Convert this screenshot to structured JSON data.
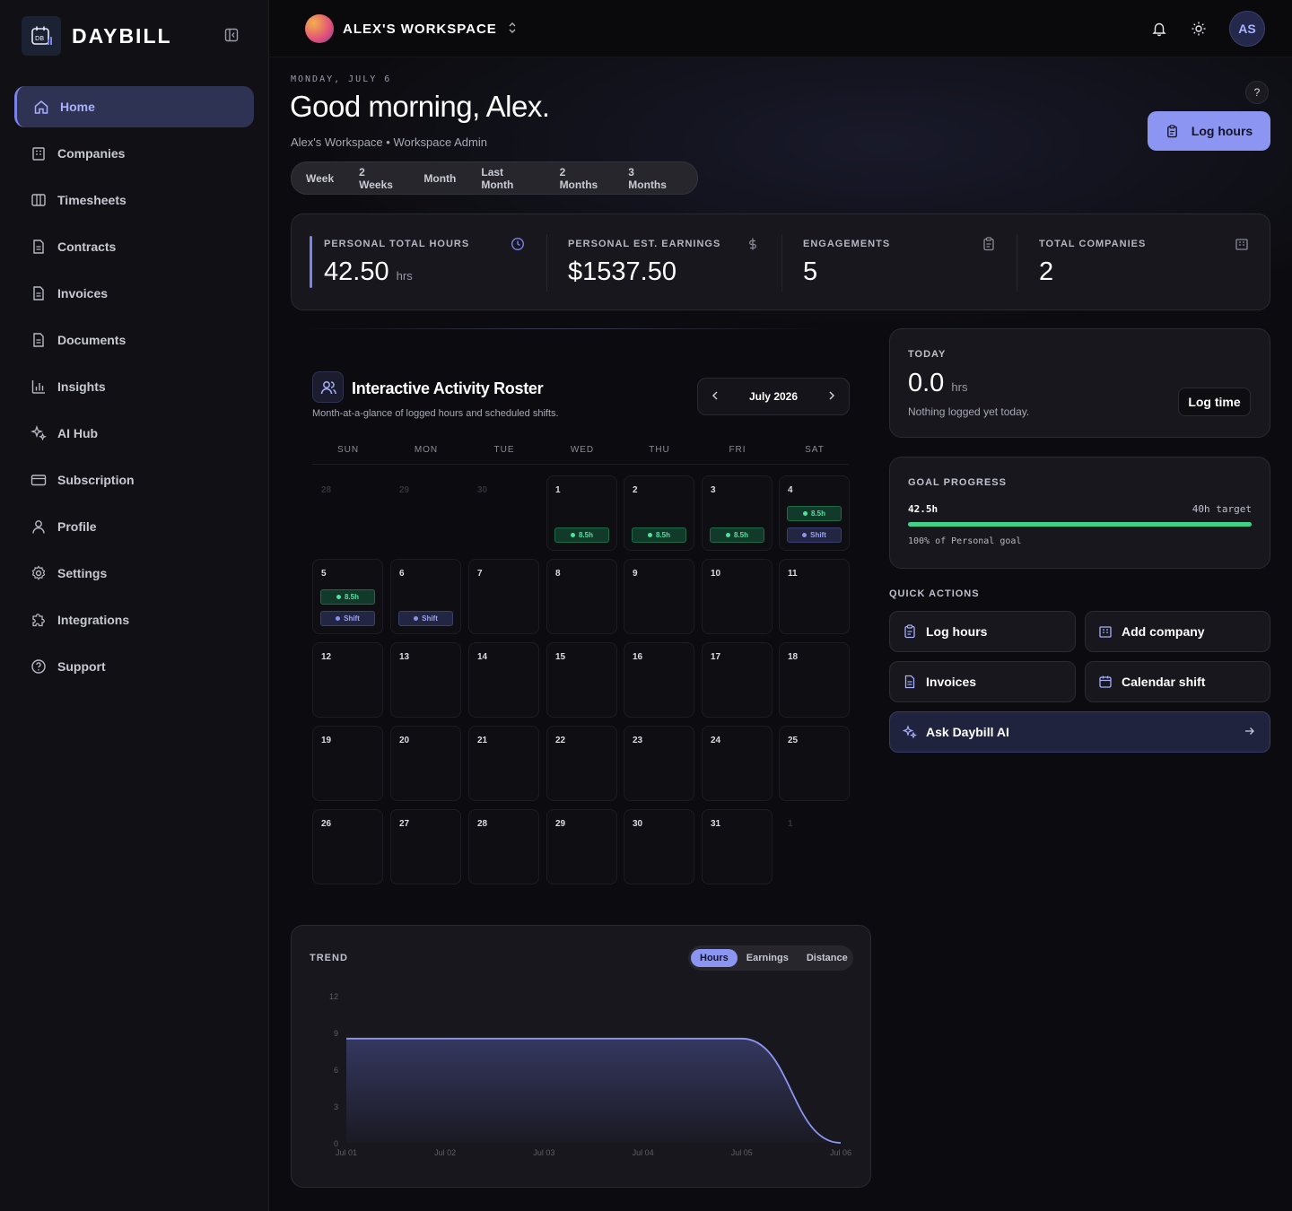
{
  "brand": {
    "name": "DAYBILL",
    "logo_text": "DB"
  },
  "sidebar": {
    "items": [
      {
        "label": "Home",
        "icon": "home-icon",
        "active": true
      },
      {
        "label": "Companies",
        "icon": "building-icon"
      },
      {
        "label": "Timesheets",
        "icon": "columns-icon"
      },
      {
        "label": "Contracts",
        "icon": "document-icon"
      },
      {
        "label": "Invoices",
        "icon": "document-icon"
      },
      {
        "label": "Documents",
        "icon": "document-icon"
      },
      {
        "label": "Insights",
        "icon": "bar-chart-icon"
      },
      {
        "label": "AI Hub",
        "icon": "sparkles-icon"
      },
      {
        "label": "Subscription",
        "icon": "card-icon"
      },
      {
        "label": "Profile",
        "icon": "user-icon"
      },
      {
        "label": "Settings",
        "icon": "gear-icon"
      },
      {
        "label": "Integrations",
        "icon": "puzzle-icon"
      },
      {
        "label": "Support",
        "icon": "help-circle-icon"
      }
    ]
  },
  "topbar": {
    "workspace": "ALEX'S WORKSPACE",
    "avatar_initials": "AS"
  },
  "header": {
    "date": "MONDAY, JULY 6",
    "greeting": "Good morning, Alex.",
    "subtitle": "Alex's Workspace • Workspace Admin",
    "help": "?",
    "log_hours_label": "Log hours",
    "ranges": [
      "Week",
      "2 Weeks",
      "Month",
      "Last Month",
      "2 Months",
      "3 Months"
    ]
  },
  "stats": [
    {
      "label": "PERSONAL TOTAL HOURS",
      "value": "42.50",
      "unit": "hrs",
      "icon": "clock-icon"
    },
    {
      "label": "PERSONAL EST. EARNINGS",
      "value": "$1537.50",
      "unit": "",
      "icon": "dollar-icon"
    },
    {
      "label": "ENGAGEMENTS",
      "value": "5",
      "unit": "",
      "icon": "clipboard-icon"
    },
    {
      "label": "TOTAL COMPANIES",
      "value": "2",
      "unit": "",
      "icon": "building-icon"
    }
  ],
  "calendar": {
    "title": "Interactive Activity Roster",
    "subtitle": "Month-at-a-glance of logged hours and scheduled shifts.",
    "month": "July 2026",
    "weekdays": [
      "SUN",
      "MON",
      "TUE",
      "WED",
      "THU",
      "FRI",
      "SAT"
    ],
    "weeks": [
      [
        {
          "d": "28",
          "out": true
        },
        {
          "d": "29",
          "out": true
        },
        {
          "d": "30",
          "out": true
        },
        {
          "d": "1",
          "hours": "8.5h"
        },
        {
          "d": "2",
          "hours": "8.5h"
        },
        {
          "d": "3",
          "hours": "8.5h"
        },
        {
          "d": "4",
          "hours": "8.5h",
          "shift": "Shift"
        }
      ],
      [
        {
          "d": "5",
          "hours": "8.5h",
          "shift": "Shift"
        },
        {
          "d": "6",
          "shift": "Shift"
        },
        {
          "d": "7"
        },
        {
          "d": "8"
        },
        {
          "d": "9"
        },
        {
          "d": "10"
        },
        {
          "d": "11"
        }
      ],
      [
        {
          "d": "12"
        },
        {
          "d": "13"
        },
        {
          "d": "14"
        },
        {
          "d": "15"
        },
        {
          "d": "16"
        },
        {
          "d": "17"
        },
        {
          "d": "18"
        }
      ],
      [
        {
          "d": "19"
        },
        {
          "d": "20"
        },
        {
          "d": "21"
        },
        {
          "d": "22"
        },
        {
          "d": "23"
        },
        {
          "d": "24"
        },
        {
          "d": "25"
        }
      ],
      [
        {
          "d": "26"
        },
        {
          "d": "27"
        },
        {
          "d": "28"
        },
        {
          "d": "29"
        },
        {
          "d": "30"
        },
        {
          "d": "31"
        },
        {
          "d": "1",
          "out": true
        }
      ]
    ]
  },
  "today": {
    "label": "TODAY",
    "value": "0.0",
    "unit": "hrs",
    "note": "Nothing logged yet today.",
    "button": "Log time"
  },
  "goal": {
    "label": "GOAL PROGRESS",
    "value": "42.5h",
    "target": "40h target",
    "progress": 1.0,
    "note": "100% of Personal goal"
  },
  "quick_actions": {
    "title": "QUICK ACTIONS",
    "items": [
      {
        "label": "Log hours",
        "icon": "clipboard-icon"
      },
      {
        "label": "Add company",
        "icon": "building-icon"
      },
      {
        "label": "Invoices",
        "icon": "document-icon"
      },
      {
        "label": "Calendar shift",
        "icon": "calendar-icon"
      }
    ],
    "ai": {
      "label": "Ask Daybill AI",
      "icon": "sparkles-icon"
    }
  },
  "trend": {
    "title": "TREND",
    "tabs": [
      "Hours",
      "Earnings",
      "Distance"
    ],
    "active_tab": "Hours"
  },
  "chart_data": {
    "type": "area",
    "x": [
      "Jul 01",
      "Jul 02",
      "Jul 03",
      "Jul 04",
      "Jul 05",
      "Jul 06"
    ],
    "series": [
      {
        "values": [
          8.5,
          8.5,
          8.5,
          8.5,
          8.5,
          0
        ]
      }
    ],
    "y_ticks": [
      0,
      3,
      6,
      9,
      12
    ],
    "ylim": [
      0,
      12
    ],
    "grid": false,
    "colors": {
      "line": "#8c95f2"
    }
  }
}
